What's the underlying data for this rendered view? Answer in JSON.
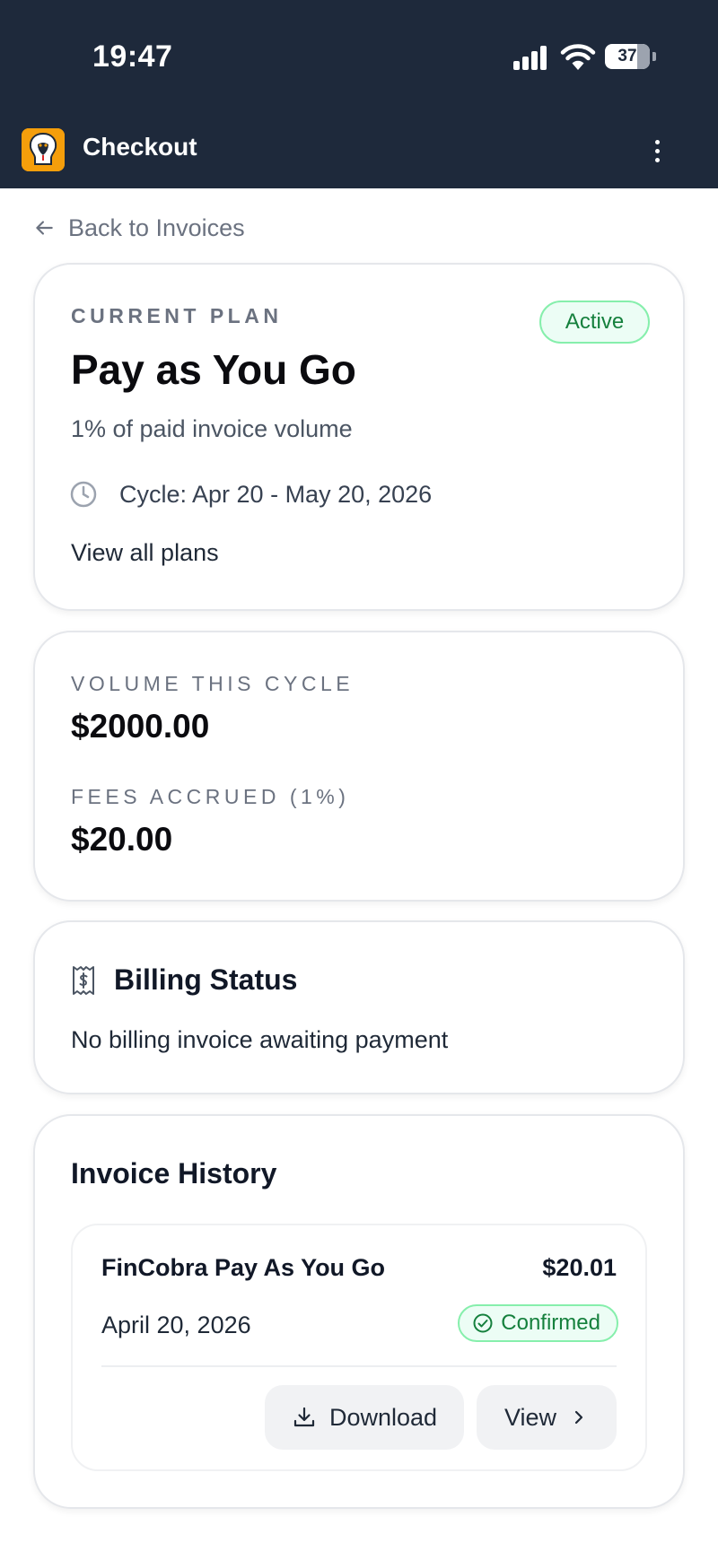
{
  "status_bar": {
    "time": "19:47",
    "battery": "37",
    "icons": [
      "signal-icon",
      "wifi-icon",
      "battery-icon"
    ]
  },
  "app_bar": {
    "title": "Checkout",
    "logo_icon": "cobra-logo-icon",
    "menu_icon": "more-vertical-icon"
  },
  "back_link": {
    "label": "Back to Invoices",
    "icon": "arrow-left-icon"
  },
  "plan_card": {
    "eyebrow": "CURRENT PLAN",
    "status": "Active",
    "name": "Pay as You Go",
    "description": "1% of paid invoice volume",
    "cycle": "Cycle: Apr 20 - May 20, 2026",
    "cycle_icon": "clock-icon",
    "view_all": "View all plans"
  },
  "metrics_card": {
    "volume_label": "VOLUME THIS CYCLE",
    "volume_value": "$2000.00",
    "fees_label": "FEES ACCRUED (1%)",
    "fees_value": "$20.00"
  },
  "billing_card": {
    "title": "Billing Status",
    "icon": "receipt-dollar-icon",
    "message": "No billing invoice awaiting payment"
  },
  "history_card": {
    "title": "Invoice History",
    "invoices": [
      {
        "name": "FinCobra Pay As You Go",
        "amount": "$20.01",
        "date": "April 20, 2026",
        "status": "Confirmed",
        "download_label": "Download",
        "view_label": "View"
      }
    ]
  },
  "colors": {
    "header_bg": "#1e293b",
    "accent_green": "#15803d",
    "badge_bg": "#ecfdf5",
    "logo_bg": "#f59e0b"
  }
}
